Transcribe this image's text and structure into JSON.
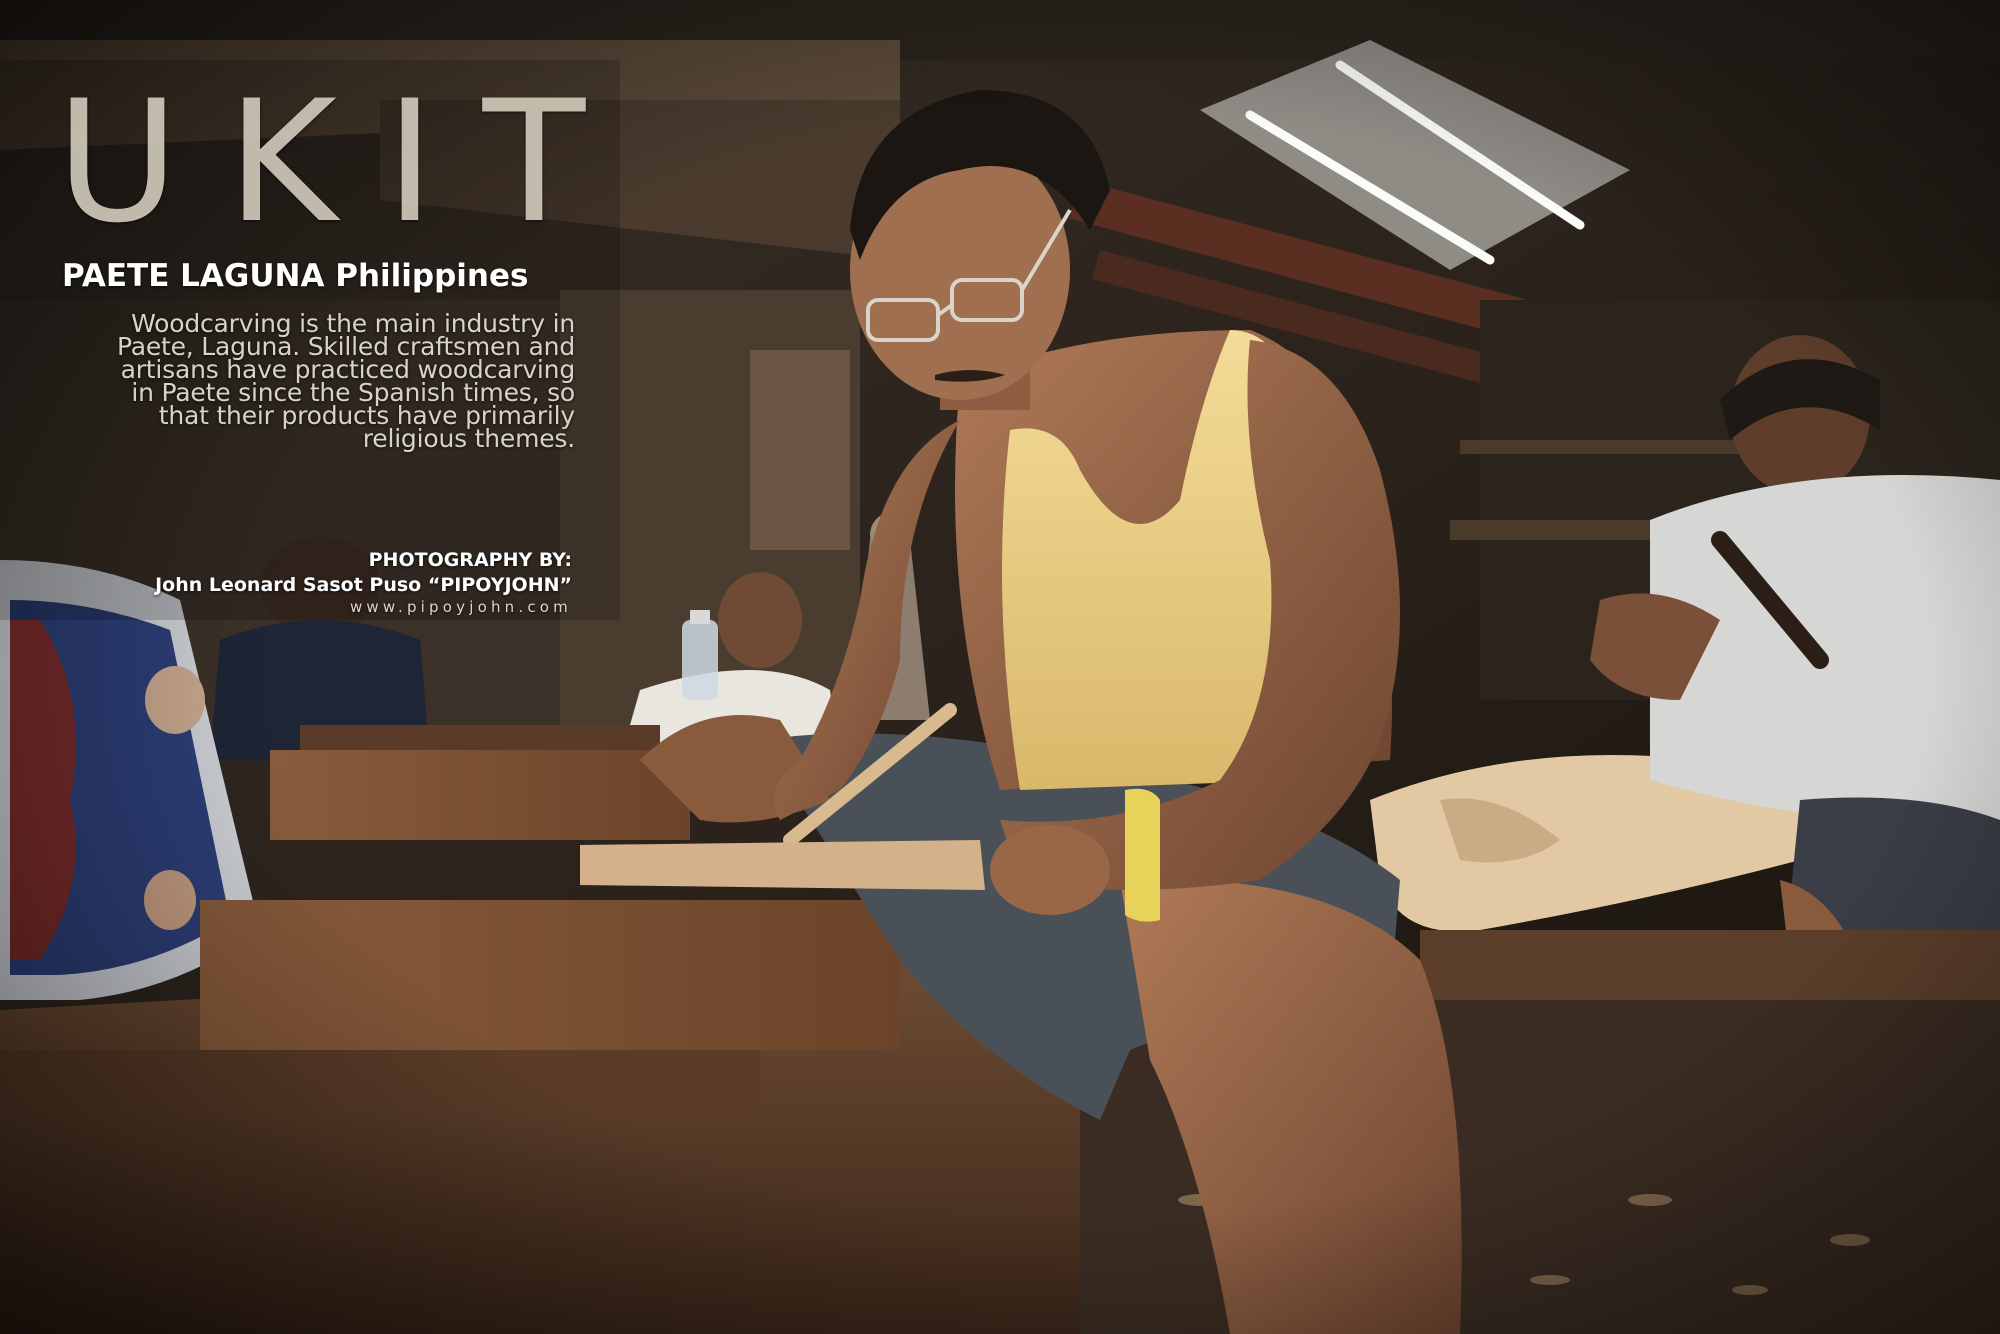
{
  "title": "UKIT",
  "subtitle": "PAETE LAGUNA Philippines",
  "description": "Woodcarving is the main industry in Paete, Laguna. Skilled craftsmen and artisans have practiced woodcarving in Paete since the Spanish times, so that their products have primarily religious themes.",
  "credit": {
    "heading": "PHOTOGRAPHY BY:",
    "name": "John Leonard Sasot Puso “PIPOYJOHN”",
    "website": "www.pipoyjohn.com"
  },
  "colors": {
    "title": "#cfc8b9",
    "text": "#ffffff",
    "background": "#1a140f"
  }
}
